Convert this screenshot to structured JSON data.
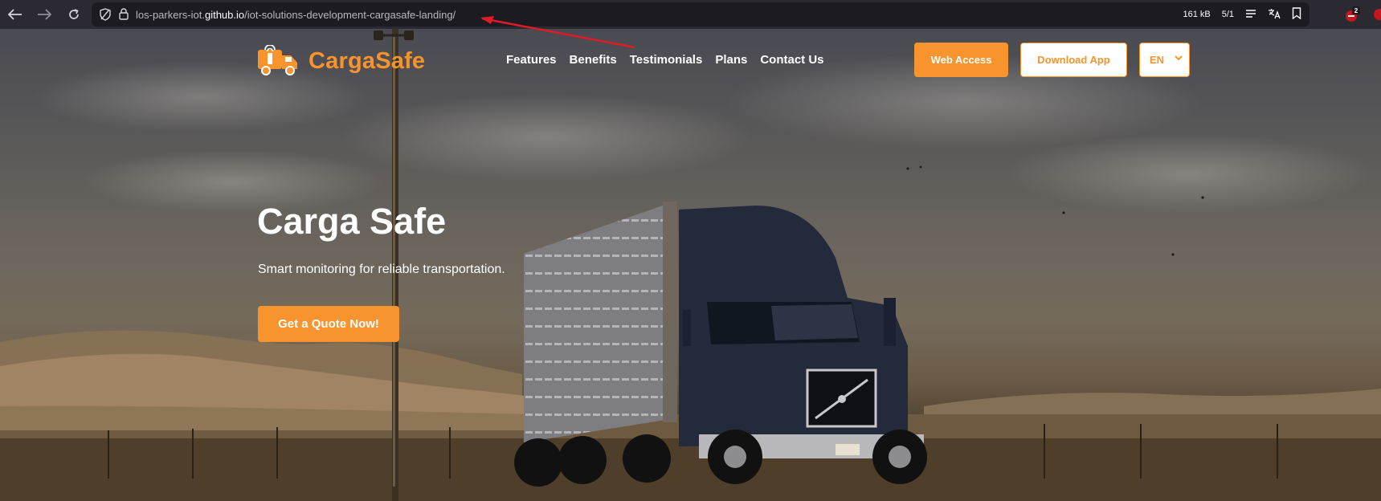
{
  "browser": {
    "url_prefix": "los-parkers-iot.",
    "url_host": "github.io",
    "url_path": "/iot-solutions-development-cargasafe-landing/",
    "page_size": "161 kB",
    "page_count": "5/1",
    "extension_badge": "2"
  },
  "header": {
    "logo_text": "CargaSafe",
    "nav": [
      "Features",
      "Benefits",
      "Testimonials",
      "Plans",
      "Contact Us"
    ],
    "web_access_label": "Web Access",
    "download_label": "Download App",
    "language": "EN"
  },
  "hero": {
    "title": "Carga Safe",
    "subtitle": "Smart monitoring for reliable transportation.",
    "cta_label": "Get a Quote Now!"
  },
  "colors": {
    "accent": "#f7942d",
    "annotation": "#e01b24",
    "browser_bar": "#2b2a33"
  }
}
